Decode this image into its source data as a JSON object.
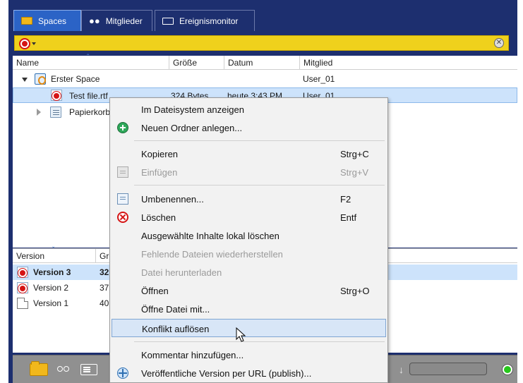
{
  "tabs": [
    {
      "label": "Spaces",
      "icon": "folder-icon",
      "active": true
    },
    {
      "label": "Mitglieder",
      "icon": "members-icon",
      "active": false
    },
    {
      "label": "Ereignismonitor",
      "icon": "event-monitor-icon",
      "active": false
    }
  ],
  "search": {
    "value": "",
    "filter_icon": "record-filter-icon",
    "clear_icon": "clear-icon"
  },
  "file_table": {
    "columns": [
      "Name",
      "Größe",
      "Datum",
      "Mitglied"
    ],
    "rows": [
      {
        "name": "Erster Space",
        "size": "",
        "date": "",
        "member": "User_01",
        "icon": "space-icon",
        "expanded": true
      },
      {
        "name": "Test file.rtf",
        "size": "324 Bytes",
        "date": "heute 3:43 PM",
        "member": "User_01",
        "icon": "file-icon",
        "selected": true
      },
      {
        "name": "Papierkorb",
        "size": "",
        "date": "",
        "member": "",
        "icon": "trash-icon",
        "expanded": false
      }
    ]
  },
  "version_table": {
    "columns": [
      "Version",
      "Gr"
    ],
    "rows": [
      {
        "label": "Version 3",
        "size": "32",
        "selected": true,
        "bold": true,
        "icon": "file-icon"
      },
      {
        "label": "Version 2",
        "size": "37",
        "selected": false,
        "bold": false,
        "icon": "file-icon"
      },
      {
        "label": "Version 1",
        "size": "40",
        "selected": false,
        "bold": false,
        "icon": "doc-icon"
      }
    ]
  },
  "context_menu": {
    "items": [
      {
        "label": "Im Dateisystem anzeigen",
        "shortcut": "",
        "icon": "",
        "disabled": false
      },
      {
        "label": "Neuen Ordner anlegen...",
        "shortcut": "",
        "icon": "add-folder-icon",
        "disabled": false
      },
      {
        "label": "Kopieren",
        "shortcut": "Strg+C",
        "icon": "",
        "disabled": false
      },
      {
        "label": "Einfügen",
        "shortcut": "Strg+V",
        "icon": "paste-icon",
        "disabled": true
      },
      {
        "label": "Umbenennen...",
        "shortcut": "F2",
        "icon": "rename-icon",
        "disabled": false
      },
      {
        "label": "Löschen",
        "shortcut": "Entf",
        "icon": "delete-icon",
        "disabled": false
      },
      {
        "label": "Ausgewählte Inhalte lokal löschen",
        "shortcut": "",
        "icon": "",
        "disabled": false
      },
      {
        "label": "Fehlende Dateien wiederherstellen",
        "shortcut": "",
        "icon": "",
        "disabled": true
      },
      {
        "label": "Datei herunterladen",
        "shortcut": "",
        "icon": "",
        "disabled": true
      },
      {
        "label": "Öffnen",
        "shortcut": "Strg+O",
        "icon": "",
        "disabled": false
      },
      {
        "label": "Öffne Datei mit...",
        "shortcut": "",
        "icon": "",
        "disabled": false
      },
      {
        "label": "Konflikt auflösen",
        "shortcut": "",
        "icon": "",
        "disabled": false,
        "hovered": true
      },
      {
        "label": "Kommentar hinzufügen...",
        "shortcut": "",
        "icon": "",
        "disabled": false
      },
      {
        "label": "Veröffentliche Version per URL (publish)...",
        "shortcut": "",
        "icon": "publish-icon",
        "disabled": false
      }
    ]
  },
  "bottom_bar": {
    "buttons": [
      "folder-icon",
      "members-icon",
      "event-monitor-icon"
    ],
    "progress": 0,
    "status_color": "#27c71c"
  },
  "colors": {
    "frame": "#1d2f6f",
    "active_tab": "#2b63c6",
    "search_bar": "#efd11c",
    "selection": "#cde3fb",
    "menu_hover": "#d8e6f7"
  }
}
